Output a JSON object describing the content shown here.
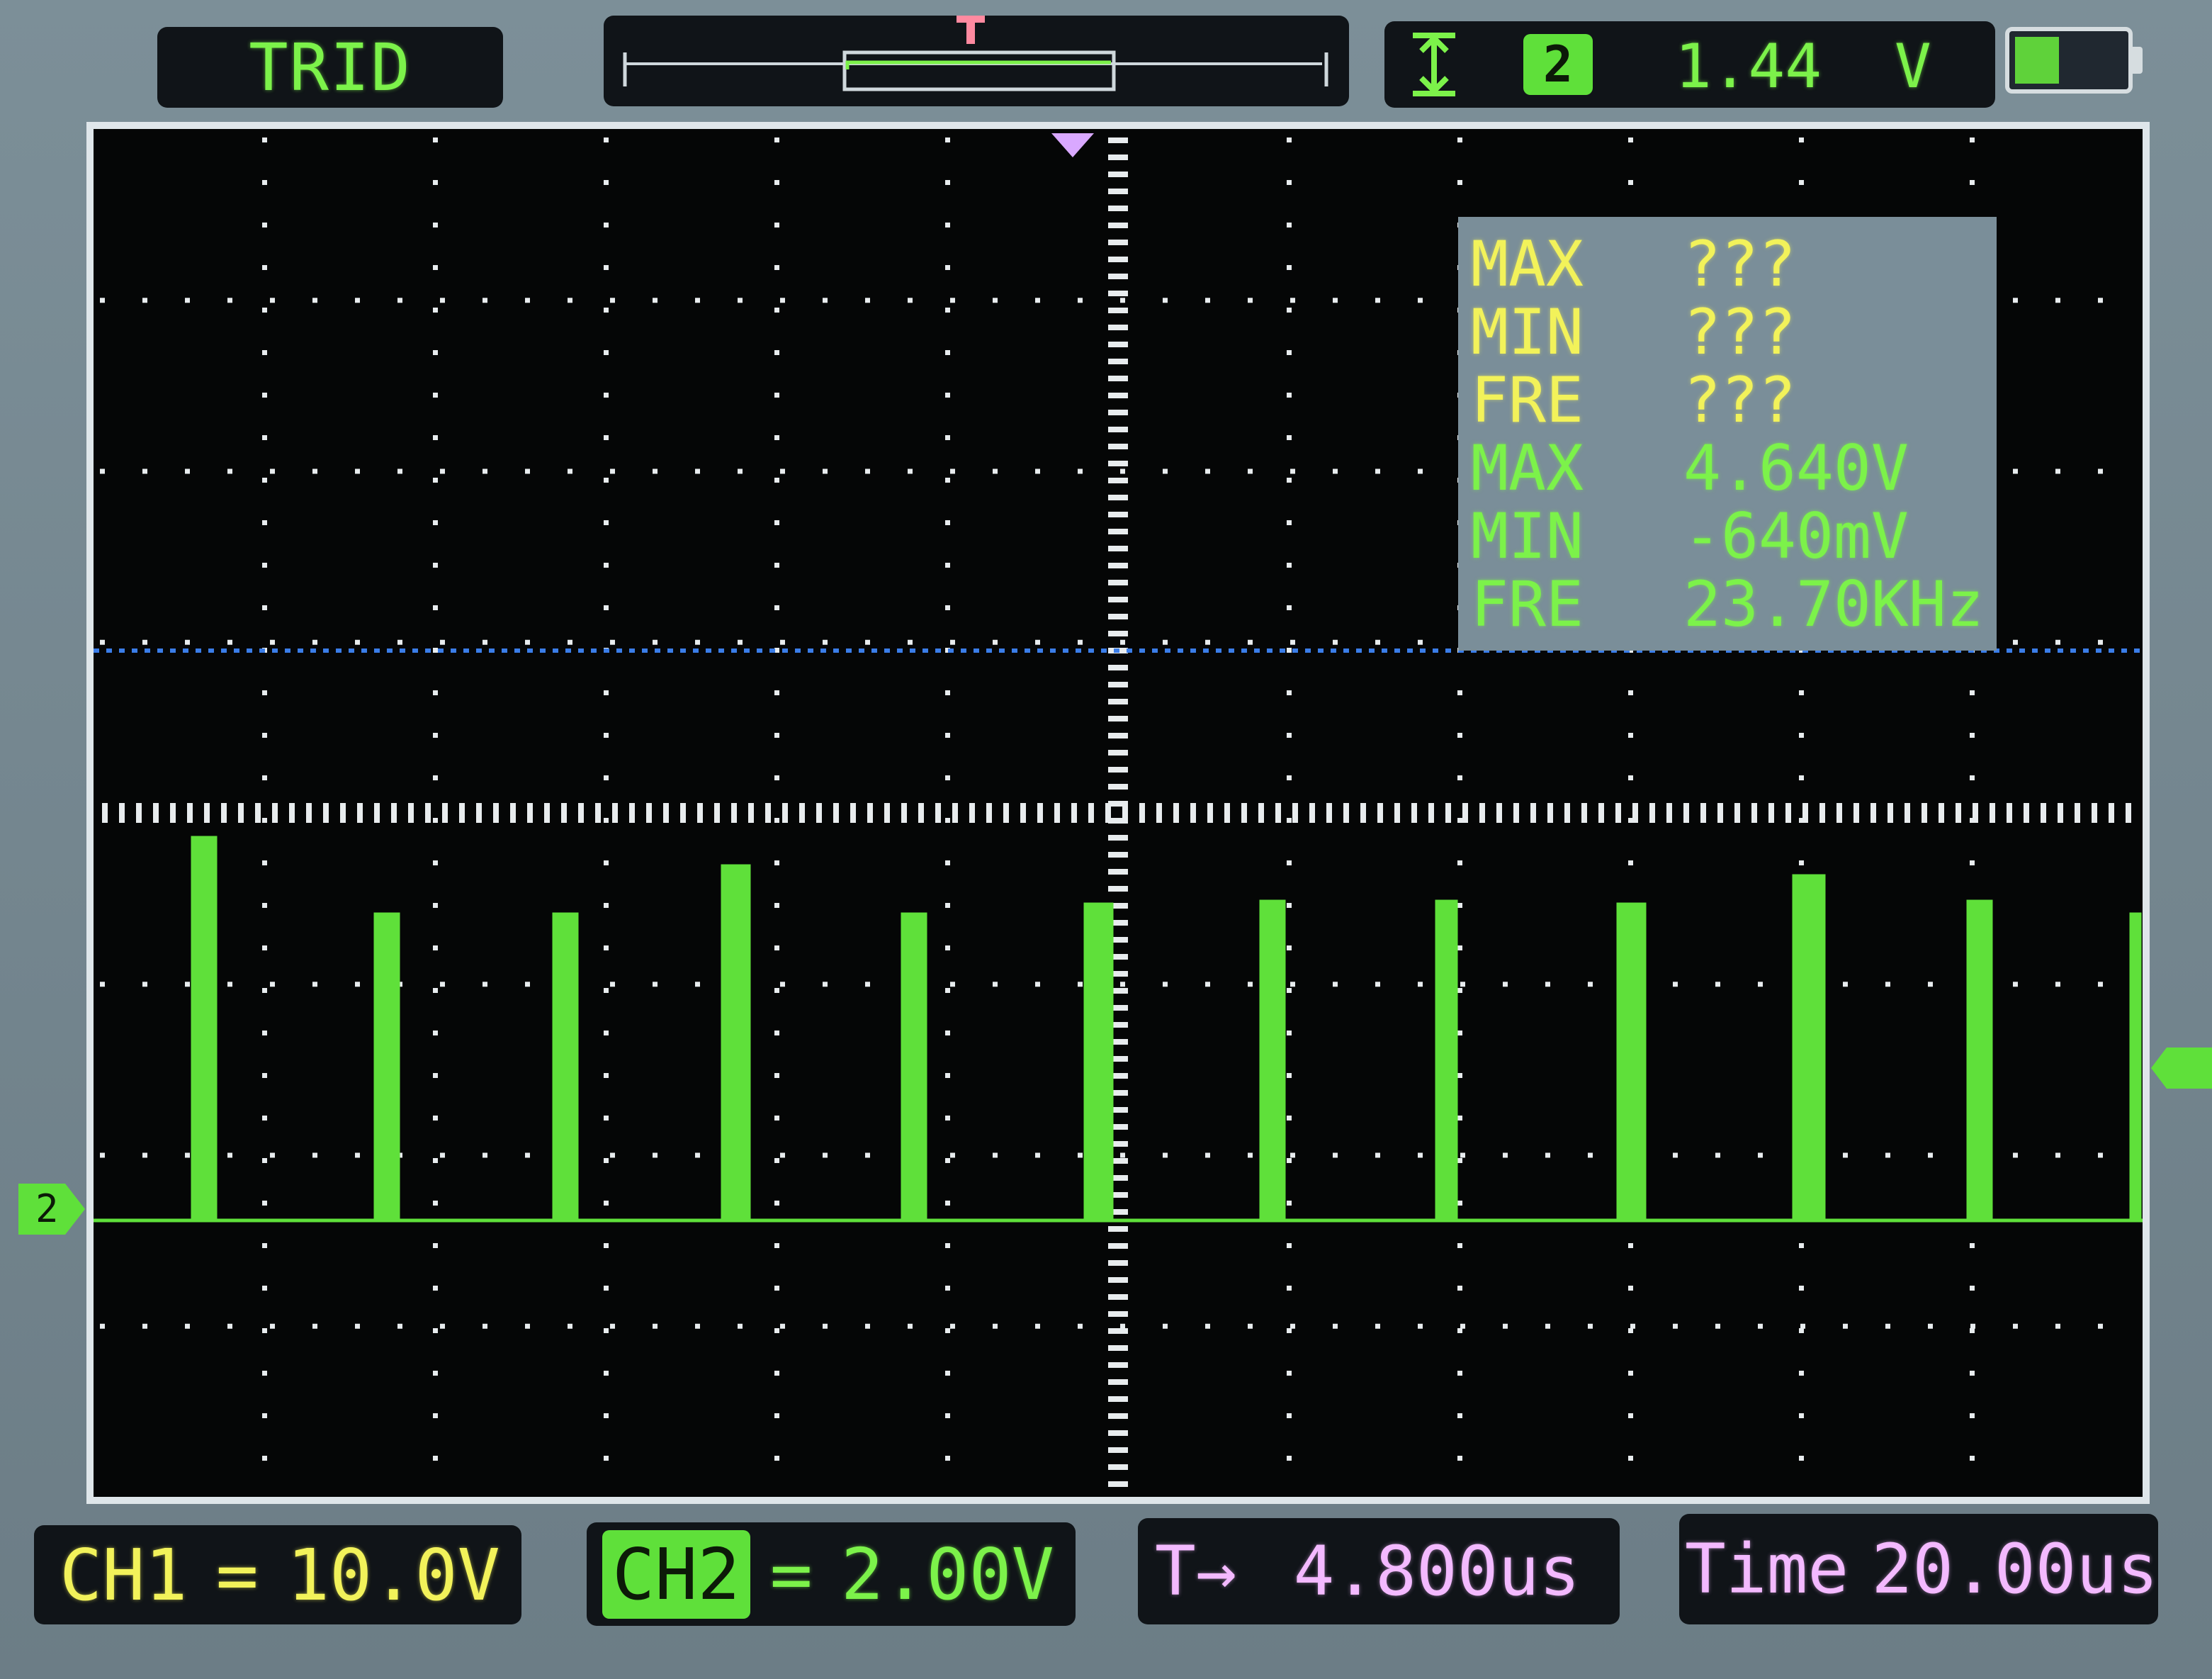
{
  "header": {
    "trigger_mode": "TRID",
    "trigger_edge_icon": "rising-falling-edge-icon",
    "trigger_channel": "2",
    "trigger_level": "1.44",
    "trigger_unit": "V",
    "battery_level_fraction": 0.4
  },
  "measurements": {
    "ch1": [
      {
        "label": "MAX",
        "value": "???"
      },
      {
        "label": "MIN",
        "value": "???"
      },
      {
        "label": "FRE",
        "value": "???"
      }
    ],
    "ch2": [
      {
        "label": "MAX",
        "value": "4.640V"
      },
      {
        "label": "MIN",
        "value": "-640mV"
      },
      {
        "label": "FRE",
        "value": "23.70KHz"
      }
    ]
  },
  "footer": {
    "ch1_label": "CH1",
    "ch1_coupling": "=",
    "ch1_scale": "10.0V",
    "ch2_label": "CH2",
    "ch2_coupling": "=",
    "ch2_scale": "2.00V",
    "trigger_pos_label": "T→",
    "trigger_pos_value": "4.800us",
    "timebase_label": "Time",
    "timebase_value": "20.00us"
  },
  "channel_marker": "2",
  "colors": {
    "ch2_trace": "#5fe03a",
    "ch1_trace": "#3a7de8",
    "ch1_text": "#f2f25a",
    "time_text": "#f3b9ff",
    "grid": "#e8ecee"
  }
}
